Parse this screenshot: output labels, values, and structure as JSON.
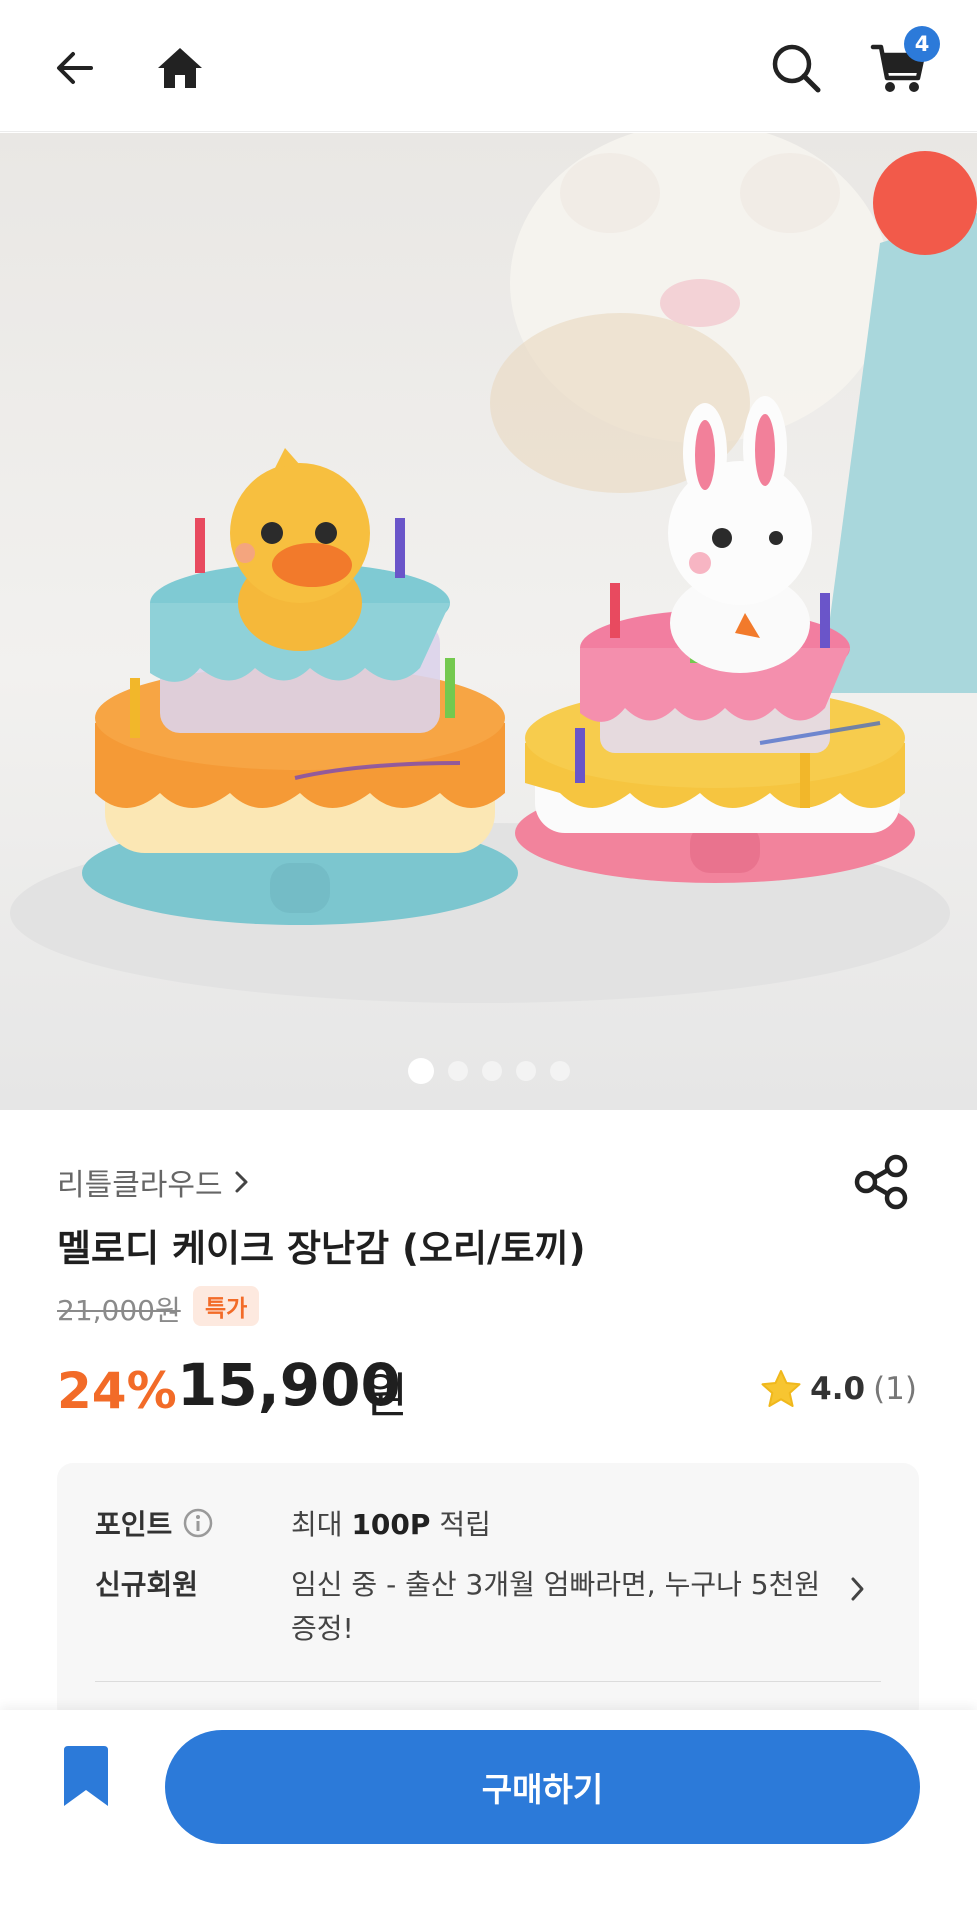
{
  "header": {
    "back_icon": "arrow-left-icon",
    "home_icon": "home-icon",
    "search_icon": "search-icon",
    "cart_icon": "cart-icon",
    "cart_count": "4"
  },
  "hero": {
    "slide_count": 5,
    "active_slide": 1
  },
  "product": {
    "brand": "리틀클라우드",
    "title": "멜로디 케이크 장난감 (오리/토끼)",
    "original_price": "21,000원",
    "tag": "특가",
    "discount": "24%",
    "price": "15,900",
    "currency": "원",
    "rating": "4.0",
    "review_count": "(1)"
  },
  "benefits": {
    "point_label": "포인트",
    "point_value_prefix": "최대",
    "point_value_amount": "100P",
    "point_value_suffix": "적립",
    "member_label": "신규회원",
    "member_value_line1": "임신 중 - 출산 3개월 엄빠라면, 누구나 5천원",
    "member_value_line2": "증정!"
  },
  "bottom": {
    "buy_label": "구매하기"
  },
  "colors": {
    "accent": "#2c7ad9",
    "discount": "#f26b28",
    "star": "#f7c531"
  }
}
